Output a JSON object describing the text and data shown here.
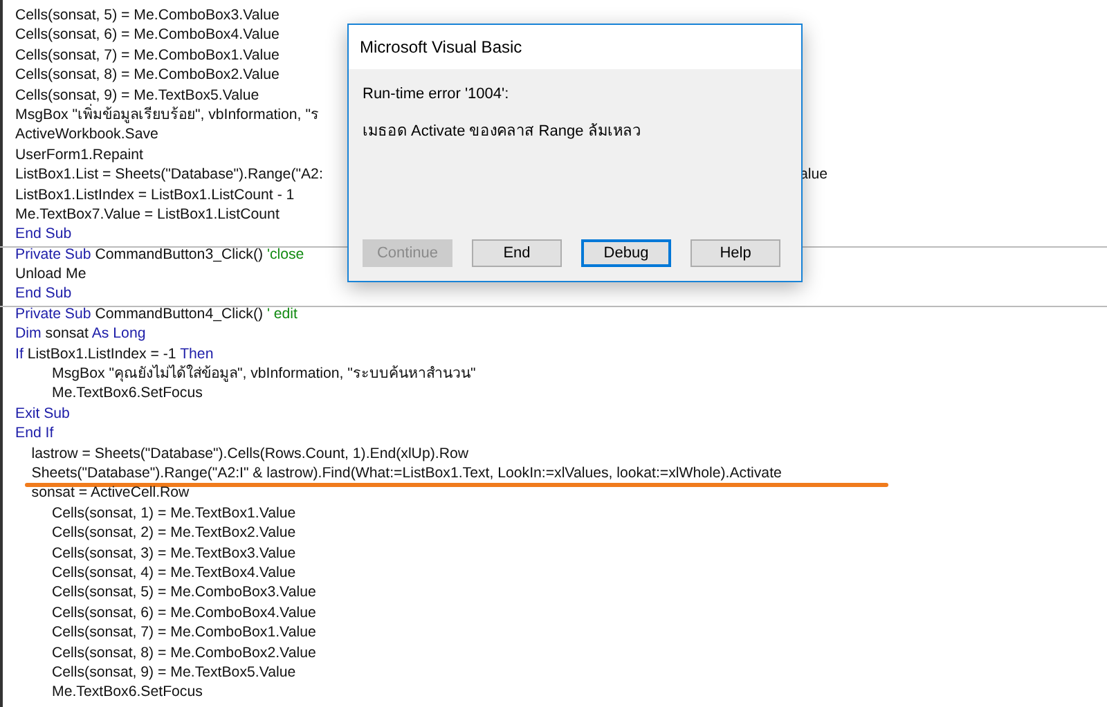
{
  "editor": {
    "lines": [
      {
        "kind": "code",
        "segments": [
          {
            "kind": "code",
            "text": "Cells(sonsat, 5) = Me.ComboBox3.Value"
          }
        ]
      },
      {
        "kind": "code",
        "segments": [
          {
            "kind": "code",
            "text": "Cells(sonsat, 6) = Me.ComboBox4.Value"
          }
        ]
      },
      {
        "kind": "code",
        "segments": [
          {
            "kind": "code",
            "text": "Cells(sonsat, 7) = Me.ComboBox1.Value"
          }
        ]
      },
      {
        "kind": "code",
        "segments": [
          {
            "kind": "code",
            "text": "Cells(sonsat, 8) = Me.ComboBox2.Value"
          }
        ]
      },
      {
        "kind": "code",
        "segments": [
          {
            "kind": "code",
            "text": "Cells(sonsat, 9) = Me.TextBox5.Value"
          }
        ]
      },
      {
        "kind": "code",
        "segments": [
          {
            "kind": "code",
            "text": "MsgBox \"เพิ่มข้อมูลเรียบร้อย\", vbInformation, \"ร"
          }
        ]
      },
      {
        "kind": "code",
        "segments": [
          {
            "kind": "code",
            "text": "ActiveWorkbook.Save"
          }
        ]
      },
      {
        "kind": "code",
        "segments": [
          {
            "kind": "code",
            "text": "UserForm1.Repaint"
          }
        ]
      },
      {
        "kind": "code",
        "segments": [
          {
            "kind": "code",
            "text": "ListBox1.List = Sheets(\"Database\").Range(\"A2:"
          }
        ],
        "tail": "alue"
      },
      {
        "kind": "code",
        "segments": [
          {
            "kind": "code",
            "text": "ListBox1.ListIndex = ListBox1.ListCount - 1"
          }
        ]
      },
      {
        "kind": "code",
        "segments": [
          {
            "kind": "code",
            "text": "Me.TextBox7.Value = ListBox1.ListCount"
          }
        ]
      },
      {
        "kind": "code",
        "segments": [
          {
            "kind": "keyword",
            "text": "End Sub"
          }
        ]
      },
      {
        "kind": "separator"
      },
      {
        "kind": "code",
        "segments": [
          {
            "kind": "keyword",
            "text": "Private Sub"
          },
          {
            "kind": "code",
            "text": " CommandButton3_Click() "
          },
          {
            "kind": "comment",
            "text": "'close"
          }
        ]
      },
      {
        "kind": "code",
        "segments": [
          {
            "kind": "code",
            "text": "Unload Me"
          }
        ]
      },
      {
        "kind": "code",
        "segments": [
          {
            "kind": "keyword",
            "text": "End Sub"
          }
        ]
      },
      {
        "kind": "separator"
      },
      {
        "kind": "code",
        "segments": [
          {
            "kind": "keyword",
            "text": "Private Sub"
          },
          {
            "kind": "code",
            "text": " CommandButton4_Click() "
          },
          {
            "kind": "comment",
            "text": "' edit"
          }
        ]
      },
      {
        "kind": "code",
        "segments": [
          {
            "kind": "keyword",
            "text": "Dim"
          },
          {
            "kind": "code",
            "text": " sonsat "
          },
          {
            "kind": "keyword",
            "text": "As Long"
          }
        ]
      },
      {
        "kind": "code",
        "segments": [
          {
            "kind": "keyword",
            "text": "If"
          },
          {
            "kind": "code",
            "text": " ListBox1.ListIndex = -1 "
          },
          {
            "kind": "keyword",
            "text": "Then"
          }
        ]
      },
      {
        "kind": "code",
        "segments": [
          {
            "kind": "code",
            "text": "         MsgBox \"คุณยังไม่ได้ใส่ข้อมูล\", vbInformation, \"ระบบค้นหาสำนวน\""
          }
        ]
      },
      {
        "kind": "code",
        "segments": [
          {
            "kind": "code",
            "text": "         Me.TextBox6.SetFocus"
          }
        ]
      },
      {
        "kind": "code",
        "segments": [
          {
            "kind": "keyword",
            "text": "Exit Sub"
          }
        ]
      },
      {
        "kind": "code",
        "segments": [
          {
            "kind": "keyword",
            "text": "End If"
          }
        ]
      },
      {
        "kind": "code",
        "segments": [
          {
            "kind": "code",
            "text": "    lastrow = Sheets(\"Database\").Cells(Rows.Count, 1).End(xlUp).Row"
          }
        ]
      },
      {
        "kind": "code",
        "segments": [
          {
            "kind": "code",
            "text": "    Sheets(\"Database\").Range(\"A2:I\" & lastrow).Find(What:=ListBox1.Text, LookIn:=xlValues, lookat:=xlWhole).Activate"
          }
        ]
      },
      {
        "kind": "underline"
      },
      {
        "kind": "code",
        "segments": [
          {
            "kind": "code",
            "text": "    sonsat = ActiveCell.Row"
          }
        ]
      },
      {
        "kind": "code",
        "segments": [
          {
            "kind": "code",
            "text": "         Cells(sonsat, 1) = Me.TextBox1.Value"
          }
        ]
      },
      {
        "kind": "code",
        "segments": [
          {
            "kind": "code",
            "text": "         Cells(sonsat, 2) = Me.TextBox2.Value"
          }
        ]
      },
      {
        "kind": "code",
        "segments": [
          {
            "kind": "code",
            "text": "         Cells(sonsat, 3) = Me.TextBox3.Value"
          }
        ]
      },
      {
        "kind": "code",
        "segments": [
          {
            "kind": "code",
            "text": "         Cells(sonsat, 4) = Me.TextBox4.Value"
          }
        ]
      },
      {
        "kind": "code",
        "segments": [
          {
            "kind": "code",
            "text": "         Cells(sonsat, 5) = Me.ComboBox3.Value"
          }
        ]
      },
      {
        "kind": "code",
        "segments": [
          {
            "kind": "code",
            "text": "         Cells(sonsat, 6) = Me.ComboBox4.Value"
          }
        ]
      },
      {
        "kind": "code",
        "segments": [
          {
            "kind": "code",
            "text": "         Cells(sonsat, 7) = Me.ComboBox1.Value"
          }
        ]
      },
      {
        "kind": "code",
        "segments": [
          {
            "kind": "code",
            "text": "         Cells(sonsat, 8) = Me.ComboBox2.Value"
          }
        ]
      },
      {
        "kind": "code",
        "segments": [
          {
            "kind": "code",
            "text": "         Cells(sonsat, 9) = Me.TextBox5.Value"
          }
        ]
      },
      {
        "kind": "code",
        "segments": [
          {
            "kind": "code",
            "text": "         Me.TextBox6.SetFocus"
          }
        ]
      }
    ]
  },
  "dialog": {
    "title": "Microsoft Visual Basic",
    "error": "Run-time error '1004':",
    "message": "เมธอด Activate ของคลาส Range ล้มเหลว",
    "buttons": [
      {
        "label": "Continue",
        "disabled": true,
        "focused": false
      },
      {
        "label": "End",
        "disabled": false,
        "focused": false
      },
      {
        "label": "Debug",
        "disabled": false,
        "focused": true
      },
      {
        "label": "Help",
        "disabled": false,
        "focused": false
      }
    ]
  }
}
